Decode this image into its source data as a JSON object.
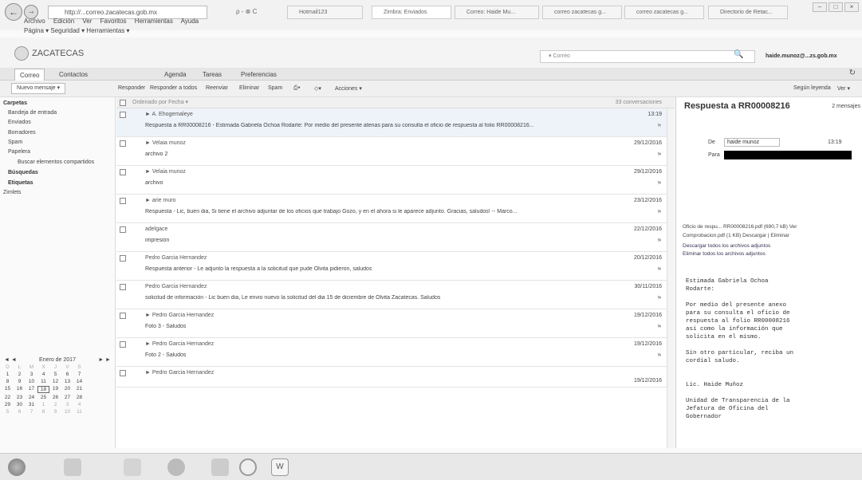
{
  "browser": {
    "url": "http://...correo.zacatecas.gob.mx",
    "addr_tools": "ρ - ⊗ C",
    "tabs": [
      "Hotmail123",
      "Zimbra: Enviados",
      "Correo: Haide Mu...",
      "correo zacatecas g...",
      "correo zacatecas g...",
      "Directorio de Retac..."
    ],
    "menu": [
      "Archivo",
      "Edición",
      "Ver",
      "Favoritos",
      "Herramientas",
      "Ayuda"
    ],
    "cmdbar": "Página ▾  Seguridad ▾  Herramientas ▾"
  },
  "app": {
    "logo": "ZACATECAS",
    "search_placeholder": "▾ Correo",
    "user": "haide.munoz@...zs.gob.mx",
    "tabs": [
      "Correo",
      "Contactos",
      "Agenda",
      "Tareas",
      "Preferencias"
    ]
  },
  "toolbar": {
    "new_message": "Nuevo mensaje ▾",
    "reply": "Responder",
    "reply_all": "Responder a todos",
    "forward": "Reenviar",
    "delete": "Eliminar",
    "spam": "Spam",
    "actions": "Acciones ▾",
    "reading_pane": "Según leyenda",
    "view": "Ver ▾"
  },
  "sidebar": {
    "folders_header": "Carpetas",
    "folders": [
      "Bandeja de entrada",
      "Enviados",
      "Borradores",
      "Spam",
      "Papelera",
      "Buscar elementos compartidos"
    ],
    "searches_header": "Búsquedas",
    "tags_header": "Etiquetas",
    "zimlets": "Zimlets"
  },
  "calendar": {
    "month": "Enero de 2017",
    "weekdays": [
      "D",
      "L",
      "M",
      "X",
      "J",
      "V",
      "S"
    ],
    "weeks": [
      [
        "1",
        "2",
        "3",
        "4",
        "5",
        "6",
        "7"
      ],
      [
        "8",
        "9",
        "10",
        "11",
        "12",
        "13",
        "14"
      ],
      [
        "15",
        "16",
        "17",
        "18",
        "19",
        "20",
        "21"
      ],
      [
        "22",
        "23",
        "24",
        "25",
        "26",
        "27",
        "28"
      ],
      [
        "29",
        "30",
        "31",
        "1",
        "2",
        "3",
        "4"
      ],
      [
        "5",
        "6",
        "7",
        "8",
        "9",
        "10",
        "11"
      ]
    ]
  },
  "list": {
    "header": "Ordenado por Fecha ▾",
    "count": "33 conversaciones",
    "messages": [
      {
        "from": "► A. Ehogemaleye",
        "subject": "Respuesta a RR00008216 - Estimada Gabriela Ochoa Rodarte: Por medio del presente atenas para su consulta el oficio de respuesta al folio RR00008216...",
        "date": "13:19"
      },
      {
        "from": "► Velaia munoz",
        "subject": "archivo 2",
        "date": "29/12/2016"
      },
      {
        "from": "► Velaia munoz",
        "subject": "archivo",
        "date": "29/12/2016"
      },
      {
        "from": "► arie muro",
        "subject": "Respuesta - Lic, buen dia, Si tiene el archivo adjuntar de los oficios que trabajo Gozo, y en el ahora si le aparece adjunto. Gracias, saludos! -- Marco...",
        "date": "23/12/2016"
      },
      {
        "from": "adelgace",
        "subject": "impresión",
        "date": "22/12/2016"
      },
      {
        "from": "Pedro Garcia Hernandez",
        "subject": "Respuesta anterior - Le adjunto la respuesta a la solicitud que pude Olvita pidieron, saludos",
        "date": "20/12/2016"
      },
      {
        "from": "Pedro Garcia Hernandez",
        "subject": "solicitud de información - Lic buen dia, Le envio nuevo la solicitud del dia 15 de diciembre de Olvita Zacatecas. Saludos",
        "date": "30/11/2016"
      },
      {
        "from": "► Pedro Garcia Hernandez",
        "subject": "Foto 3 - Saludos",
        "date": "19/12/2016"
      },
      {
        "from": "► Pedro Garcia Hernandez",
        "subject": "Foto 2 - Saludos",
        "date": "19/12/2016"
      },
      {
        "from": "► Pedro Garcia Hernandez",
        "subject": "",
        "date": "19/12/2016"
      }
    ]
  },
  "reader": {
    "title": "Respuesta a RR00008216",
    "count": "2 mensajes",
    "de_label": "De",
    "de_value": "haide munoz",
    "time": "13:19",
    "para_label": "Para",
    "att1": "Oficio de respu... RR00008216.pdf (690,7 kB) Ver",
    "att2": "Comprobacion.pdf (1 KB) Descargar | Eliminar",
    "att3": "Descargar todos los archivos adjuntos",
    "att4": "Eliminar todos los archivos adjuntos",
    "body": "Estimada Gabriela Ochoa\nRodarte:\n\nPor medio del presente anexo\npara su consulta el oficio de\nrespuesta al folio RR00008216\nasí como la información que\nsolicita en el mismo.\n\nSin otro particular, reciba un\ncordial saludo.\n\n\nLic. Haide Muñoz\n\nUnidad de Transparencia de la\nJefatura de Oficina del\nGobernador"
  }
}
